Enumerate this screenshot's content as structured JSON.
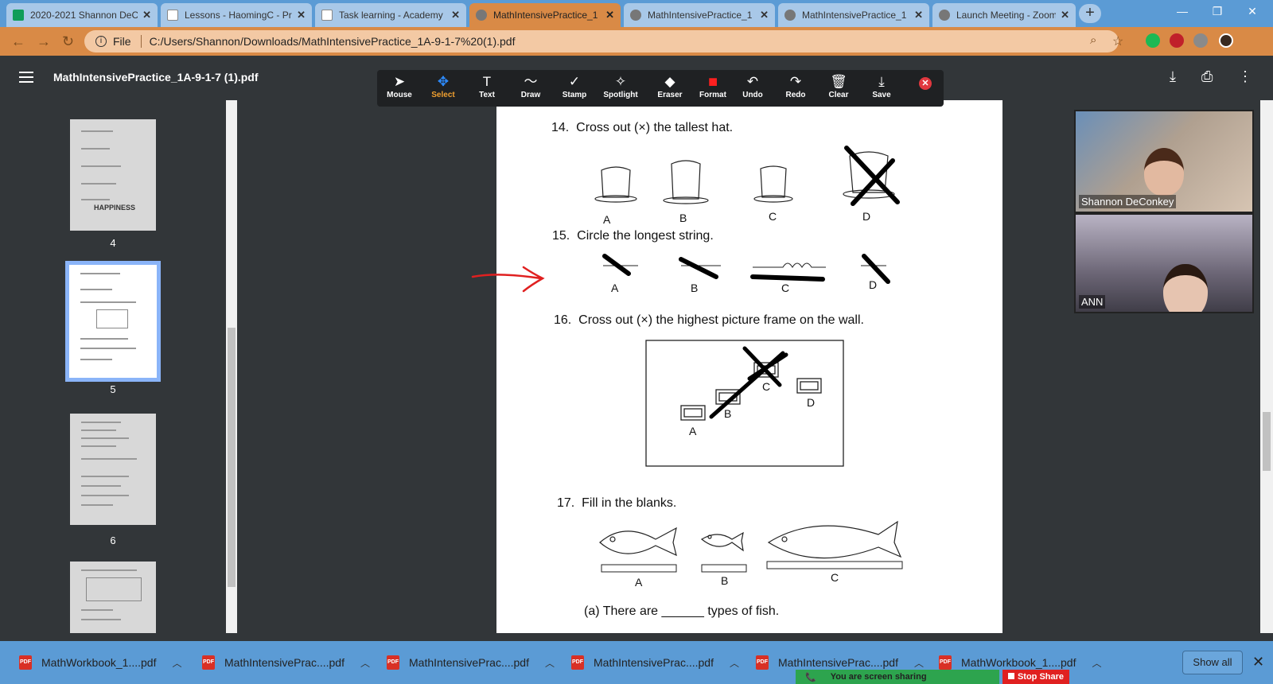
{
  "browser": {
    "tabs": [
      {
        "title": "2020-2021 Shannon DeC",
        "favicon": "sheets-icon",
        "color": "#0f9d58"
      },
      {
        "title": "Lessons - HaomingC - Pr",
        "favicon": "doc-icon",
        "color": "#ffffff"
      },
      {
        "title": "Task learning - Academy",
        "favicon": "doc-icon",
        "color": "#ffffff"
      },
      {
        "title": "MathIntensivePractice_1",
        "favicon": "globe-icon",
        "color": "#777777"
      },
      {
        "title": "MathIntensivePractice_1",
        "favicon": "globe-icon",
        "color": "#777777"
      },
      {
        "title": "MathIntensivePractice_1",
        "favicon": "globe-icon",
        "color": "#777777"
      },
      {
        "title": "Launch Meeting - Zoom",
        "favicon": "globe-icon",
        "color": "#777777"
      }
    ],
    "new_tab": "+",
    "address": {
      "scheme_label": "File",
      "url": "C:/Users/Shannon/Downloads/MathIntensivePractice_1A-9-1-7%20(1).pdf"
    }
  },
  "pdf_viewer": {
    "title": "MathIntensivePractice_1A-9-1-7 (1).pdf",
    "thumbnails": [
      {
        "page": "4",
        "text": "HAPPINESS"
      },
      {
        "page": "5"
      },
      {
        "page": "6"
      }
    ]
  },
  "annotation_toolbar": {
    "tools": [
      {
        "label": "Mouse",
        "icon": "pointer-icon",
        "glyph": "➤"
      },
      {
        "label": "Select",
        "icon": "move-icon",
        "glyph": "✥",
        "selected": true
      },
      {
        "label": "Text",
        "icon": "text-icon",
        "glyph": "T"
      },
      {
        "label": "Draw",
        "icon": "draw-icon",
        "glyph": "〜"
      },
      {
        "label": "Stamp",
        "icon": "stamp-icon",
        "glyph": "✓"
      },
      {
        "label": "Spotlight",
        "icon": "spotlight-icon",
        "glyph": "✧"
      },
      {
        "label": "Eraser",
        "icon": "eraser-icon",
        "glyph": "◆"
      },
      {
        "label": "Format",
        "icon": "format-icon",
        "glyph": "■"
      },
      {
        "label": "Undo",
        "icon": "undo-icon",
        "glyph": "↶"
      },
      {
        "label": "Redo",
        "icon": "redo-icon",
        "glyph": "↷"
      },
      {
        "label": "Clear",
        "icon": "trash-icon",
        "glyph": "🗑"
      },
      {
        "label": "Save",
        "icon": "save-icon",
        "glyph": "⤓"
      }
    ],
    "format_color": "#ff2020"
  },
  "worksheet": {
    "q14": {
      "number": "14.",
      "text": "Cross out (×) the tallest hat.",
      "labels": [
        "A",
        "B",
        "C",
        "D"
      ]
    },
    "q15": {
      "number": "15.",
      "text": "Circle the longest string.",
      "labels": [
        "A",
        "B",
        "C",
        "D"
      ]
    },
    "q16": {
      "number": "16.",
      "text": "Cross out (×) the highest picture frame on the wall.",
      "labels": [
        "A",
        "B",
        "C",
        "D"
      ]
    },
    "q17": {
      "number": "17.",
      "text": "Fill in the blanks.",
      "labels": [
        "A",
        "B",
        "C"
      ],
      "sub_a": "(a)  There are ______ types of fish."
    }
  },
  "zoom": {
    "participants": [
      {
        "name": "Shannon DeConkey"
      },
      {
        "name": "ANN"
      }
    ],
    "sharing_text": "You are screen sharing",
    "stop_share": "Stop Share"
  },
  "downloads": {
    "items": [
      "MathWorkbook_1....pdf",
      "MathIntensivePrac....pdf",
      "MathIntensivePrac....pdf",
      "MathIntensivePrac....pdf",
      "MathIntensivePrac....pdf",
      "MathWorkbook_1....pdf"
    ],
    "show_all": "Show all"
  }
}
